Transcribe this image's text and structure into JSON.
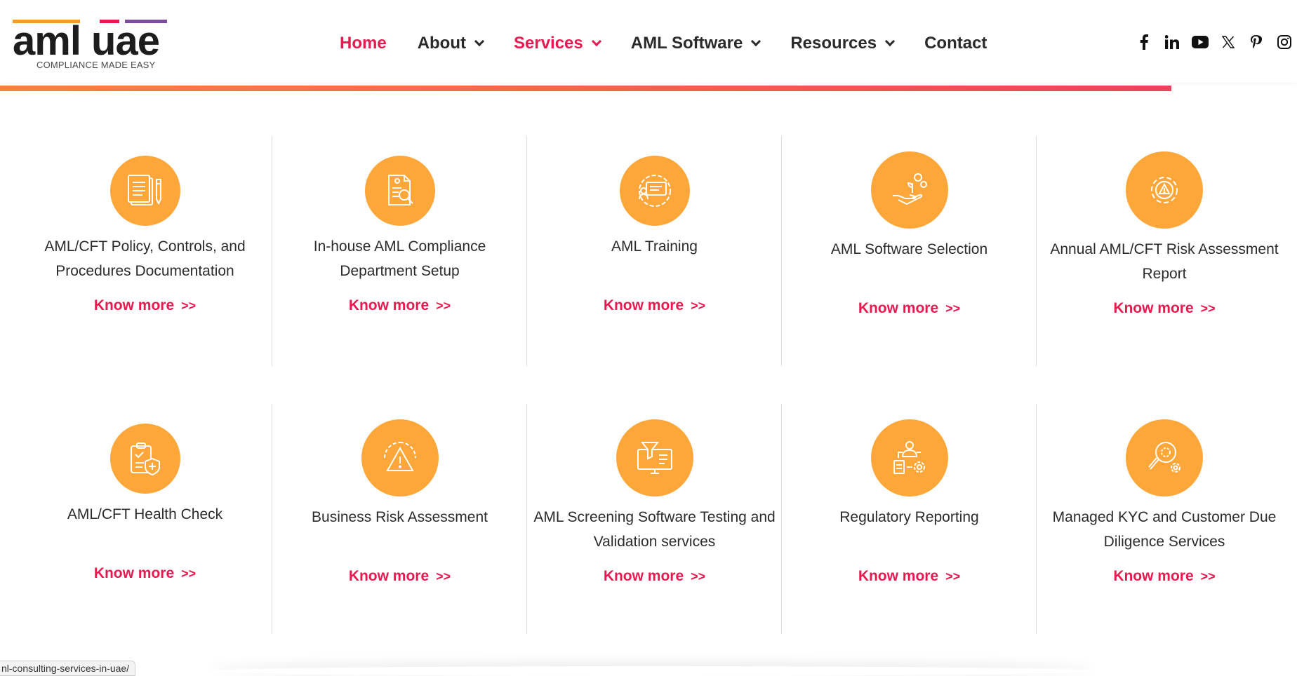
{
  "brand": {
    "logo_text": "aml uae",
    "tagline": "COMPLIANCE MADE EASY",
    "bar_colors": [
      "#f59a2b",
      "#e8194f",
      "#7c4d9e"
    ]
  },
  "nav": {
    "items": [
      {
        "label": "Home",
        "active": true,
        "dropdown": false
      },
      {
        "label": "About",
        "active": false,
        "dropdown": true
      },
      {
        "label": "Services",
        "active": true,
        "dropdown": true
      },
      {
        "label": "AML Software",
        "active": false,
        "dropdown": true
      },
      {
        "label": "Resources",
        "active": false,
        "dropdown": true
      },
      {
        "label": "Contact",
        "active": false,
        "dropdown": false
      }
    ]
  },
  "social": [
    "facebook-icon",
    "linkedin-icon",
    "youtube-icon",
    "x-icon",
    "pinterest-icon",
    "instagram-icon"
  ],
  "colors": {
    "accent": "#e8194f",
    "icon_bg": "#fda63a",
    "gradient_start": "#f5843a",
    "gradient_end": "#e8435e"
  },
  "services": {
    "know_more": "Know more",
    "know_more_arrow": ">>",
    "row1": [
      {
        "title": "AML/CFT Policy, Controls, and Procedures Documentation",
        "icon": "document-pen-icon"
      },
      {
        "title": "In-house AML Compliance Department Setup",
        "icon": "document-search-icon"
      },
      {
        "title": "AML Training",
        "icon": "training-gear-icon"
      },
      {
        "title": "AML Software Selection",
        "icon": "hand-coins-icon"
      },
      {
        "title": "Annual AML/CFT Risk Assessment Report",
        "icon": "gear-warning-icon"
      }
    ],
    "row2": [
      {
        "title": "AML/CFT Health Check",
        "icon": "clipboard-shield-icon"
      },
      {
        "title": "Business Risk Assessment",
        "icon": "warning-gear-icon"
      },
      {
        "title": "AML Screening Software Testing and Validation services",
        "icon": "monitor-funnel-icon"
      },
      {
        "title": "Regulatory Reporting",
        "icon": "person-report-icon"
      },
      {
        "title": "Managed KYC and Customer Due Diligence Services",
        "icon": "magnifier-gears-icon"
      }
    ]
  },
  "status_bar": {
    "url": "nl-consulting-services-in-uae/"
  }
}
